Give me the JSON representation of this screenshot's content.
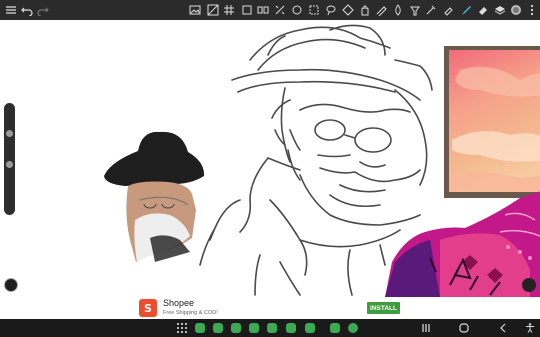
{
  "toolbar": {
    "icons": [
      "menu-icon",
      "undo-icon",
      "redo-icon",
      "image-icon",
      "adjust-icon",
      "grid-icon",
      "crop-icon",
      "flip-icon",
      "transform-icon",
      "select-rect-icon",
      "move-icon",
      "lasso-icon",
      "hand-icon",
      "eraser-icon",
      "smudge-icon",
      "fill-icon",
      "magic-wand-icon",
      "eyedropper-icon",
      "brush-icon",
      "eraser-tool-icon",
      "layers-icon",
      "color-icon",
      "more-icon"
    ],
    "accent": "#4fb0e8"
  },
  "ad": {
    "brand": "Shopee",
    "subtitle": "Free Shipping & COD!",
    "install_label": "INSTALL",
    "brand_color": "#ee4d2d",
    "install_color": "#3f9b3f"
  },
  "nav": {
    "recents_icon": "recents-icon",
    "home_icon": "home-icon",
    "back_icon": "back-icon",
    "accessibility_icon": "accessibility-icon"
  }
}
